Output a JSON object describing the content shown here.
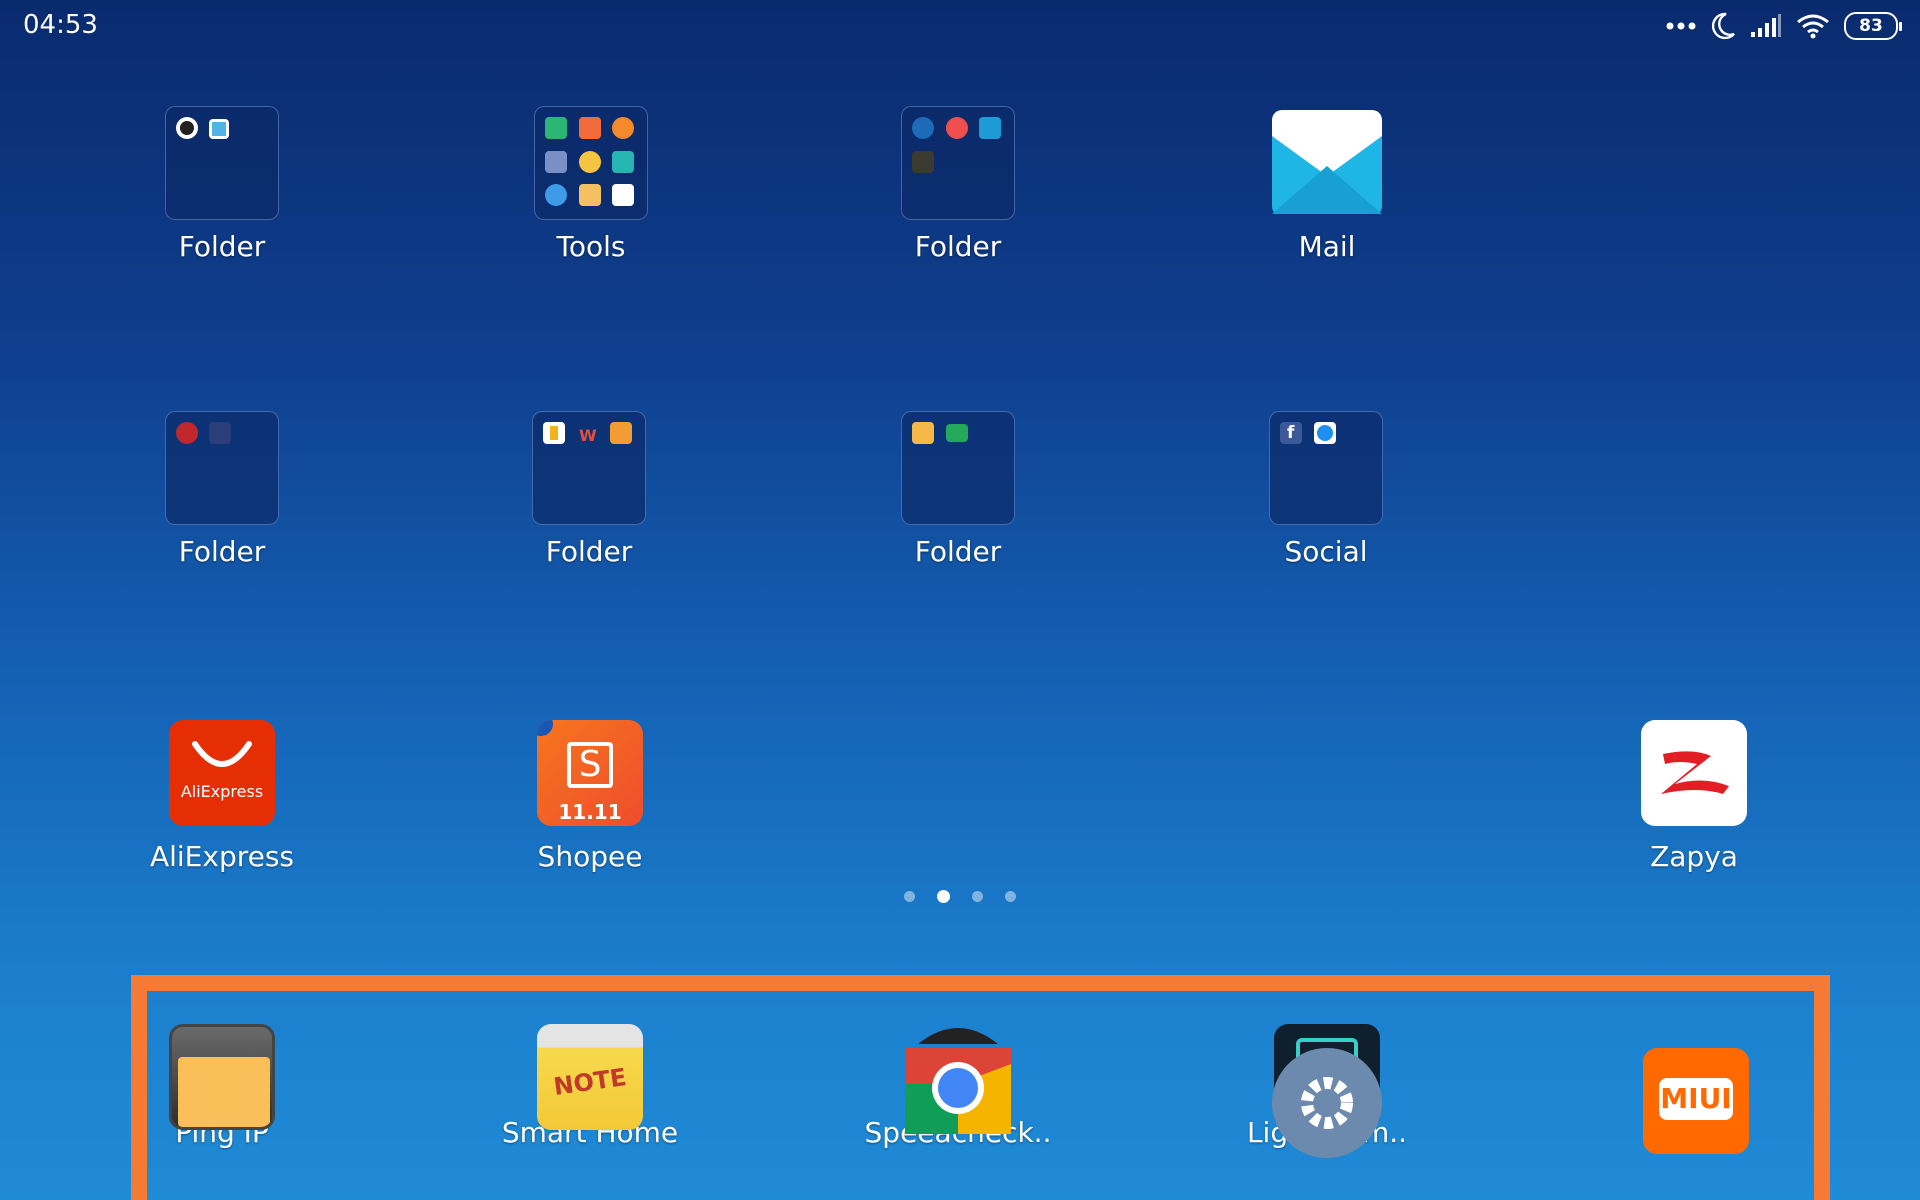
{
  "status_bar": {
    "time": "04:53",
    "battery": "83"
  },
  "row1": [
    {
      "label": "Folder"
    },
    {
      "label": "Tools"
    },
    {
      "label": "Folder"
    },
    {
      "label": "Mail"
    }
  ],
  "row2": [
    {
      "label": "Folder"
    },
    {
      "label": "Folder"
    },
    {
      "label": "Folder"
    },
    {
      "label": "Social"
    }
  ],
  "row3": [
    {
      "label": "AliExpress",
      "icon_text": "AliExpress"
    },
    {
      "label": "Shopee",
      "icon_text": "S",
      "icon_sub": "11.11"
    },
    {
      "label": "Zapya"
    }
  ],
  "page_indicator": {
    "pages": 4,
    "active": 2
  },
  "dock": [
    {
      "label": "Ping IP"
    },
    {
      "label": "Smart Home",
      "icon_text": "NOTE"
    },
    {
      "label": "Speeacheck.."
    },
    {
      "label": "Lightroom.."
    },
    {
      "label": "",
      "icon_text": "MIUI"
    }
  ],
  "colors": {
    "highlight": "#f47a36",
    "aliexpress": "#e62e04",
    "shopee": "#f05d23",
    "miui": "#ff6900"
  }
}
